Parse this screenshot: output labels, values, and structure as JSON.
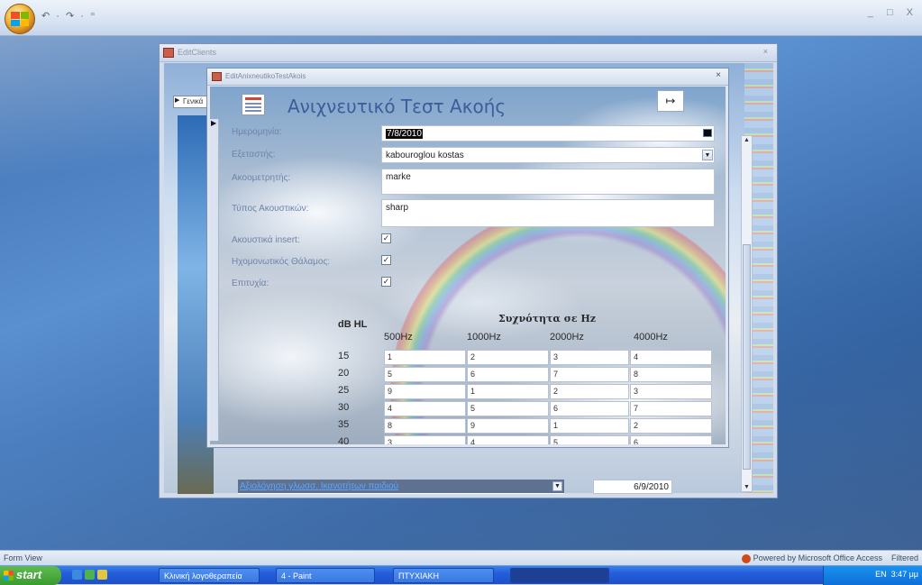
{
  "app": {
    "quick_access": "↶ · ↷ · ⁼",
    "window_controls": "_ □ X",
    "status_left": "Form View",
    "status_right": "Powered by Microsoft Office Access",
    "status_filtered": "Filtered"
  },
  "taskbar": {
    "start": "start",
    "tasks": [
      "Κλινική λογοθεραπεία",
      "4 - Paint",
      "ΠΤΥΧΙΑΚΗ",
      ""
    ],
    "tray_lang": "EN",
    "tray_time": "3:47 μμ"
  },
  "back_window": {
    "title": "EditClients",
    "close": "×",
    "tab_label": "Γενικά",
    "eval_link": "Αξιολόγηση γλωσσ. Ικανοτήτων παιδιού",
    "eval_date": "6/9/2010"
  },
  "front_window": {
    "title": "EditAnixneutikoTestAkois",
    "close": "×",
    "form_title": "Ανιχνευτικό Τεστ Ακοής",
    "close_button_glyph": "↦",
    "fields": {
      "date_label": "Ημερομηνία:",
      "date_value": "7/8/2010",
      "examiner_label": "Εξεταστής:",
      "examiner_value": "kabouroglou kostas",
      "audiometer_label": "Ακοομετρητής:",
      "audiometer_value": "marke",
      "headphones_label": "Τύπος Ακουστικών:",
      "headphones_value": "sharp",
      "insert_label": "Ακουστικά insert:",
      "booth_label": "Ηχομονωτικός Θάλαμος:",
      "success_label": "Επιτυχία:",
      "check": "✓"
    },
    "freq_title": "Συχνότητα σε Hz",
    "db_header": "dB HL",
    "freq_headers": [
      "500Hz",
      "1000Hz",
      "2000Hz",
      "4000Hz"
    ],
    "db_levels": [
      "15",
      "20",
      "25",
      "30",
      "35",
      "40"
    ],
    "grid": [
      [
        "1",
        "2",
        "3",
        "4"
      ],
      [
        "5",
        "6",
        "7",
        "8"
      ],
      [
        "9",
        "1",
        "2",
        "3"
      ],
      [
        "4",
        "5",
        "6",
        "7"
      ],
      [
        "8",
        "9",
        "1",
        "2"
      ],
      [
        "3",
        "4",
        "5",
        "6"
      ]
    ]
  }
}
